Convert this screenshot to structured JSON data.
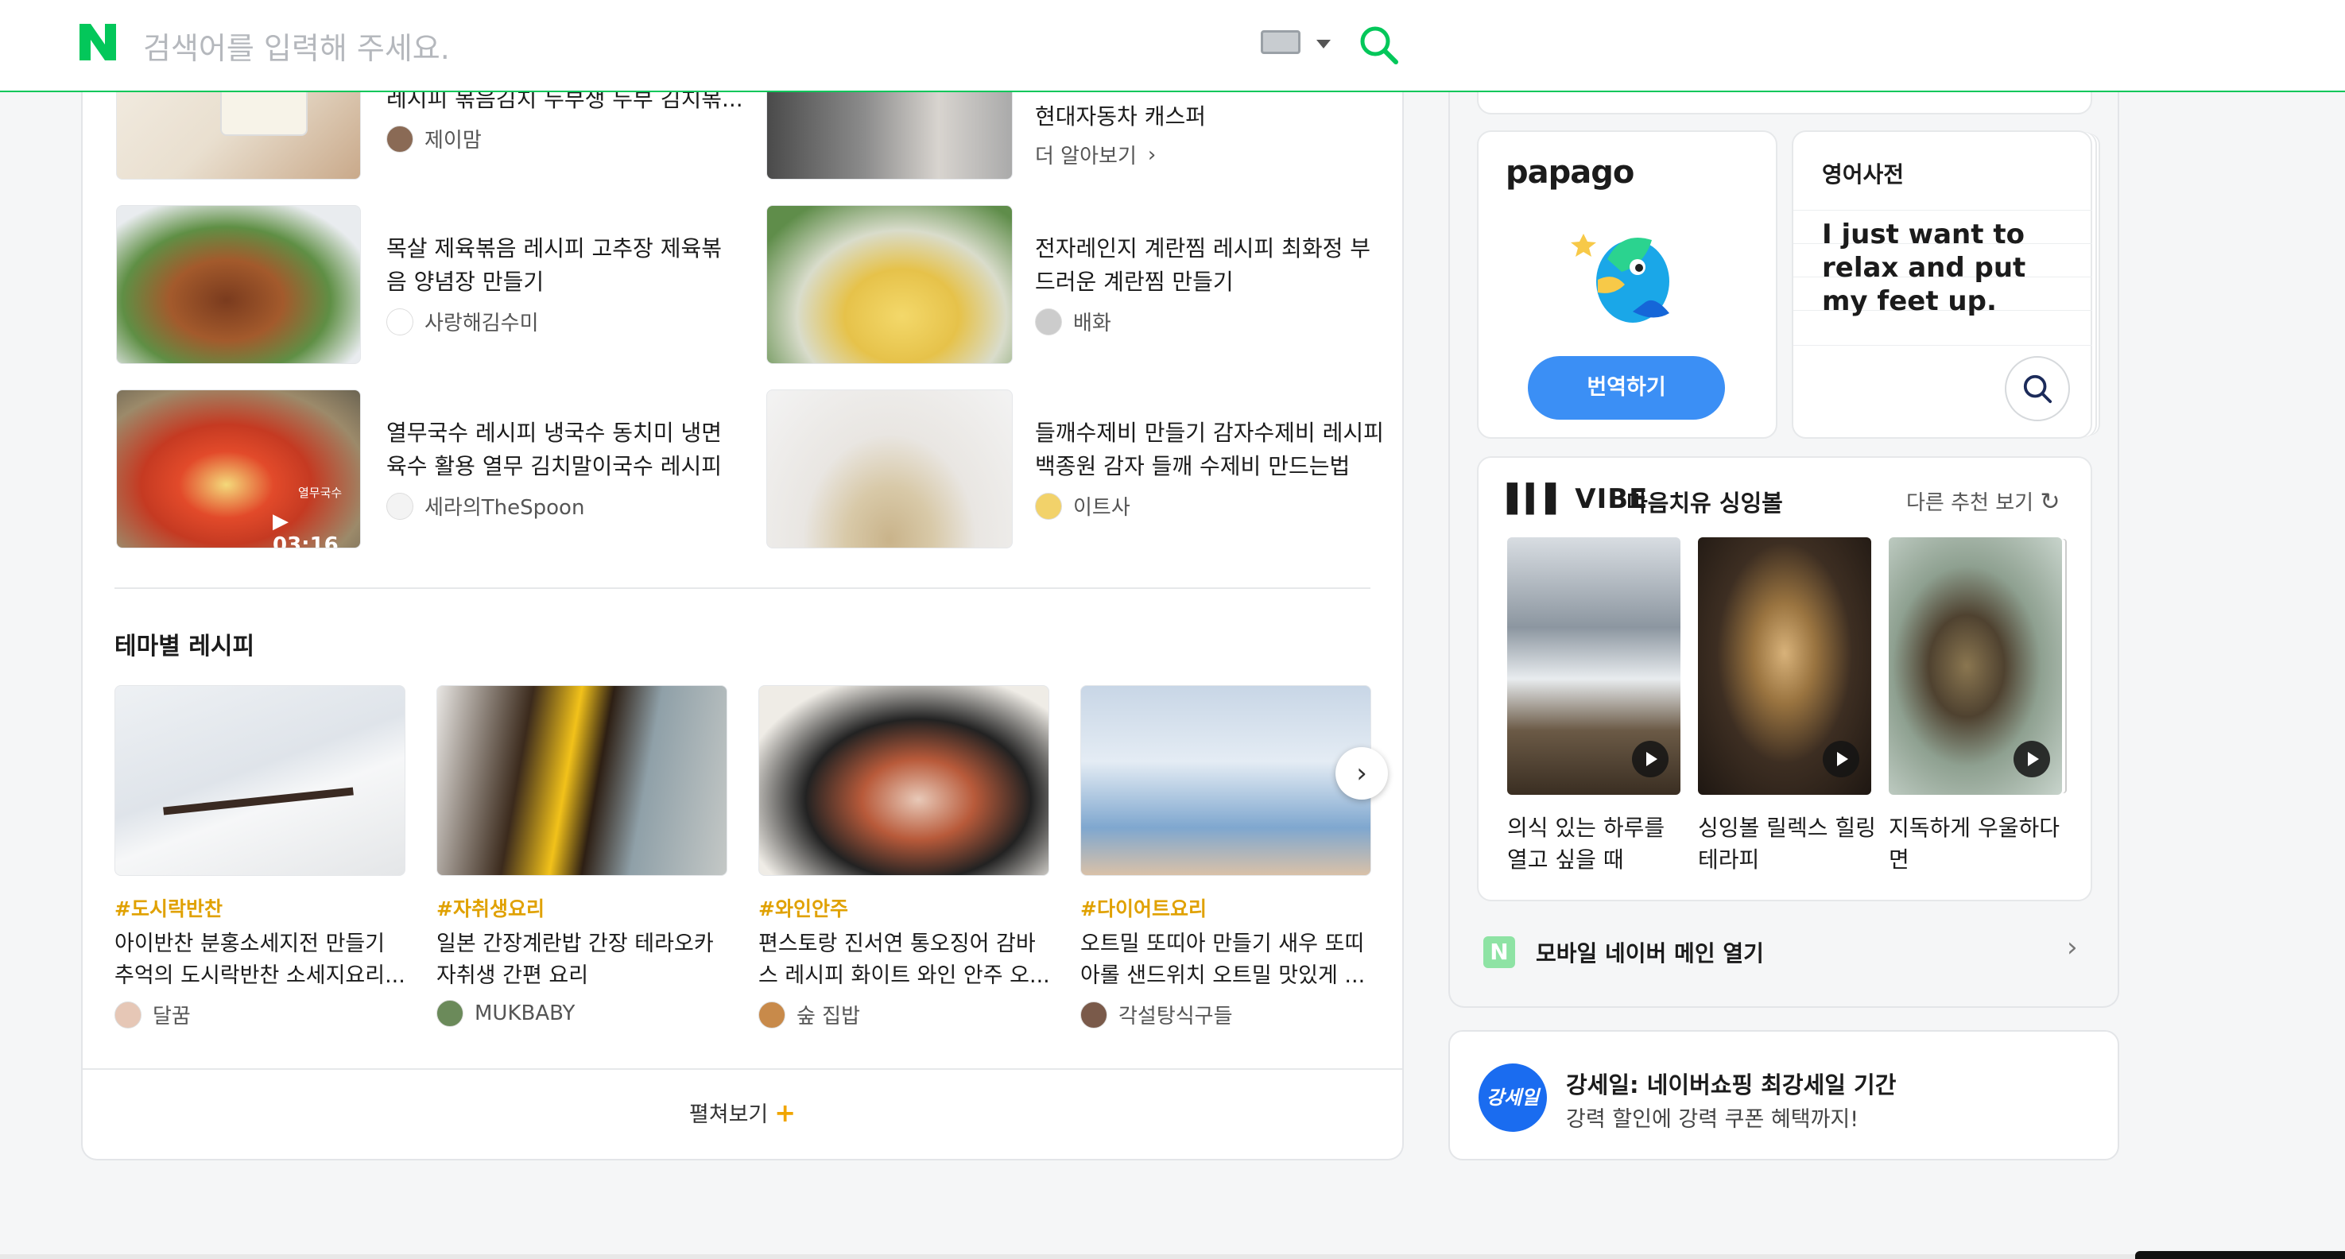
{
  "header": {
    "logo": "N",
    "search_placeholder": "검색어를 입력해 주세요.",
    "keyboard_icon": "keyboard-icon",
    "search_icon": "search-icon"
  },
  "recipes": [
    {
      "title": "레시피 볶음김치 두부생 두부 김치볶...",
      "author": "제이맘"
    },
    {
      "title": "현대자동차 캐스퍼",
      "author": "더 알아보기"
    },
    {
      "title": "목살 제육볶음 레시피 고추장 제육볶음 양념장 만들기",
      "author": "사랑해김수미"
    },
    {
      "title": "전자레인지 계란찜 레시피 최화정 부드러운 계란찜 만들기",
      "author": "배화"
    },
    {
      "title": "열무국수 레시피 냉국수 동치미 냉면육수 활용 열무 김치말이국수 레시피",
      "author": "세라의TheSpoon",
      "video_label": "열무국수",
      "duration": "03:16"
    },
    {
      "title": "들깨수제비 만들기 감자수제비 레시피 백종원 감자 들깨 수제비 만드는법",
      "author": "이트사"
    }
  ],
  "themes": {
    "title": "테마별 레시피",
    "items": [
      {
        "tag": "#도시락반찬",
        "title": "아이반찬 분홍소세지전 만들기 추억의 도시락반찬 소세지요리...",
        "author": "달꿈"
      },
      {
        "tag": "#자취생요리",
        "title": "일본 간장계란밥 간장 테라오카 자취생 간편 요리",
        "author": "MUKBABY"
      },
      {
        "tag": "#와인안주",
        "title": "편스토랑 진서연 통오징어 감바스 레시피 화이트 와인 안주 오...",
        "author": "숲 집밥"
      },
      {
        "tag": "#다이어트요리",
        "title": "오트밀 또띠아 만들기 새우 또띠아롤 샌드위치 오트밀 맛있게 ...",
        "author": "각설탕식구들"
      }
    ],
    "more_label": "펼쳐보기",
    "more_plus": "+"
  },
  "papago": {
    "logo": "papago",
    "button": "번역하기"
  },
  "dictionary": {
    "title": "영어사전",
    "sentence": "I just want to relax and put my feet up."
  },
  "vibe": {
    "logo": "VIBE",
    "title": "마음치유 싱잉볼",
    "other": "다른 추천 보기",
    "items": [
      {
        "label": "의식 있는 하루를 열고 싶을 때"
      },
      {
        "label": "싱잉볼 릴렉스 힐링 테라피"
      },
      {
        "label": "지독하게 우울하다면"
      }
    ]
  },
  "mobile": {
    "icon": "N",
    "label": "모바일 네이버 메인 열기"
  },
  "ad": {
    "badge": "강세일",
    "title": "강세일: 네이버쇼핑 최강세일 기간",
    "subtitle": "강력 할인에 강력 쿠폰 혜택까지!"
  },
  "colors": {
    "naver_green": "#03c75a",
    "tag_orange": "#e0a100",
    "papago_blue": "#3b8ff5"
  }
}
